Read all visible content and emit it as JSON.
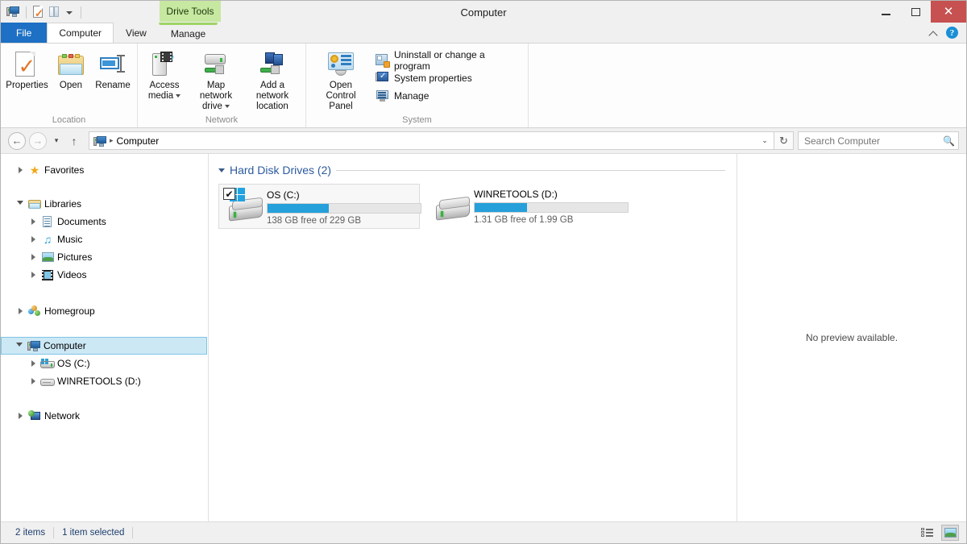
{
  "window": {
    "title": "Computer",
    "contextual_tab_label": "Drive Tools",
    "minimize_label": "Minimize",
    "maximize_label": "Maximize",
    "close_label": "Close"
  },
  "quick_access": {
    "items": [
      {
        "name": "computer-icon",
        "label": "Computer"
      },
      {
        "name": "properties-icon",
        "label": "Properties"
      },
      {
        "name": "open-icon",
        "label": "Open"
      },
      {
        "name": "customize-caret",
        "label": "Customize Quick Access Toolbar"
      }
    ]
  },
  "tabs": [
    {
      "label": "File",
      "active": false,
      "style": "file"
    },
    {
      "label": "Computer",
      "active": true,
      "style": "normal"
    },
    {
      "label": "View",
      "active": false,
      "style": "normal"
    },
    {
      "label": "Manage",
      "active": false,
      "style": "contextual"
    }
  ],
  "ribbon": {
    "collapse_tooltip": "Minimize the Ribbon",
    "help_glyph": "?",
    "groups": [
      {
        "label": "Location",
        "buttons": [
          {
            "label": "Properties",
            "icon": "properties-icon",
            "split": false
          },
          {
            "label": "Open",
            "icon": "open-folder-icon",
            "split": false
          },
          {
            "label": "Rename",
            "icon": "rename-icon",
            "split": false
          }
        ]
      },
      {
        "label": "Network",
        "buttons": [
          {
            "label": "Access media",
            "icon": "access-media-icon",
            "split": true
          },
          {
            "label": "Map network drive",
            "icon": "map-network-drive-icon",
            "split": true
          },
          {
            "label": "Add a network location",
            "icon": "add-network-location-icon",
            "split": false
          }
        ]
      },
      {
        "label": "System",
        "big_button": {
          "label": "Open Control Panel",
          "icon": "control-panel-icon"
        },
        "small_buttons": [
          {
            "label": "Uninstall or change a program",
            "icon": "uninstall-program-icon"
          },
          {
            "label": "System properties",
            "icon": "system-properties-icon"
          },
          {
            "label": "Manage",
            "icon": "manage-icon"
          }
        ]
      }
    ]
  },
  "address_bar": {
    "back_glyph": "←",
    "forward_glyph": "→",
    "recent_caret": "▾",
    "up_glyph": "↑",
    "location_icon": "computer-icon",
    "crumbs": [
      "Computer"
    ],
    "crumb_separator": "▸",
    "dropdown_caret": "⌄",
    "refresh_glyph": "↻",
    "search_placeholder": "Search Computer",
    "search_value": "",
    "search_icon": "search-icon"
  },
  "navigation_pane": {
    "items": [
      {
        "label": "Favorites",
        "icon": "star-icon",
        "level": 0,
        "expander": "collapsed",
        "selected": false,
        "gap_after": true
      },
      {
        "label": "Libraries",
        "icon": "libraries-icon",
        "level": 0,
        "expander": "expanded",
        "selected": false
      },
      {
        "label": "Documents",
        "icon": "documents-icon",
        "level": 1,
        "expander": "collapsed",
        "selected": false
      },
      {
        "label": "Music",
        "icon": "music-icon",
        "level": 1,
        "expander": "collapsed",
        "selected": false
      },
      {
        "label": "Pictures",
        "icon": "pictures-icon",
        "level": 1,
        "expander": "collapsed",
        "selected": false
      },
      {
        "label": "Videos",
        "icon": "videos-icon",
        "level": 1,
        "expander": "collapsed",
        "selected": false,
        "gap_after": true
      },
      {
        "label": "Homegroup",
        "icon": "homegroup-icon",
        "level": 0,
        "expander": "collapsed",
        "selected": false,
        "gap_after": true
      },
      {
        "label": "Computer",
        "icon": "computer-icon",
        "level": 0,
        "expander": "expanded",
        "selected": true
      },
      {
        "label": "OS (C:)",
        "icon": "hard-drive-icon",
        "level": 1,
        "expander": "collapsed",
        "selected": false
      },
      {
        "label": "WINRETOOLS (D:)",
        "icon": "drive-icon",
        "level": 1,
        "expander": "collapsed",
        "selected": false,
        "gap_after": true
      },
      {
        "label": "Network",
        "icon": "network-icon",
        "level": 0,
        "expander": "collapsed",
        "selected": false
      }
    ]
  },
  "content": {
    "group": {
      "title": "Hard Disk Drives (2)",
      "expanded": true
    },
    "drives": [
      {
        "name": "OS (C:)",
        "capacity_text": "138 GB free of 229 GB",
        "free_gb": 138,
        "total_gb": 229,
        "used_percent": 40,
        "selected": true,
        "checkbox_checked": true,
        "checkbox_glyph": "✔",
        "has_windows_logo": true,
        "bar_color": "#26a0da"
      },
      {
        "name": "WINRETOOLS (D:)",
        "capacity_text": "1.31 GB free of 1.99 GB",
        "free_gb": 1.31,
        "total_gb": 1.99,
        "used_percent": 34,
        "selected": false,
        "checkbox_checked": false,
        "checkbox_glyph": "",
        "has_windows_logo": false,
        "bar_color": "#26a0da"
      }
    ]
  },
  "preview_pane": {
    "message": "No preview available."
  },
  "status_bar": {
    "item_count": "2 items",
    "selection": "1 item selected",
    "views": [
      {
        "name": "details-view-button",
        "label": "Details view",
        "active": false
      },
      {
        "name": "large-icons-view-button",
        "label": "Large icons view",
        "active": true
      }
    ]
  },
  "colors": {
    "accent_blue": "#26a0da",
    "file_tab_blue": "#1d70c4",
    "contextual_green": "#c6e8a0",
    "selection_blue": "#cce8f5",
    "close_red": "#c75050",
    "group_header_blue": "#2c5aa0"
  }
}
